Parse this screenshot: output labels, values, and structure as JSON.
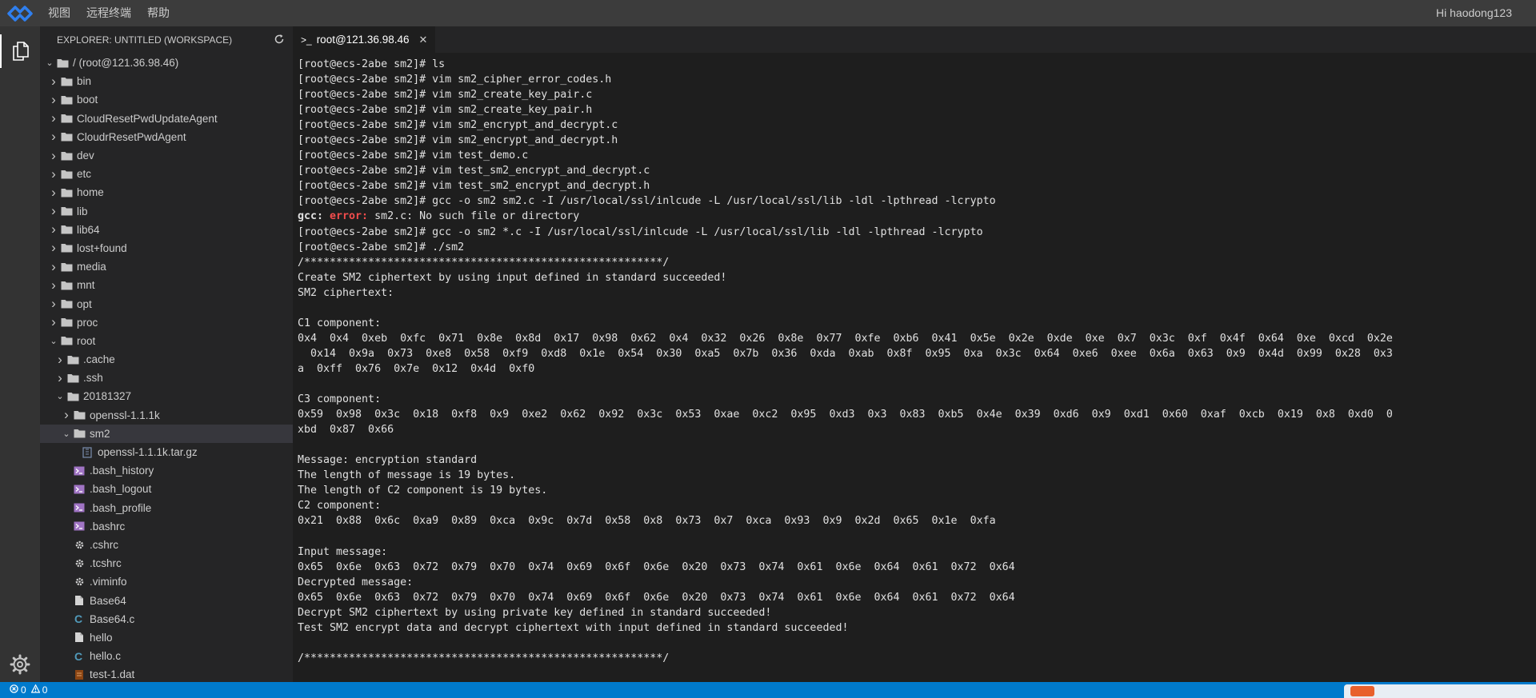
{
  "menubar": {
    "items": [
      "视图",
      "远程终端",
      "帮助"
    ],
    "greeting": "Hi haodong123"
  },
  "sidebar": {
    "title": "EXPLORER: UNTITLED (WORKSPACE)",
    "root_label": "/ (root@121.36.98.46)",
    "items": [
      {
        "label": "bin",
        "icon": "folder-icon",
        "level": 1,
        "expanded": false
      },
      {
        "label": "boot",
        "icon": "folder-icon",
        "level": 1,
        "expanded": false
      },
      {
        "label": "CloudResetPwdUpdateAgent",
        "icon": "folder-icon",
        "level": 1,
        "expanded": false
      },
      {
        "label": "CloudrResetPwdAgent",
        "icon": "folder-icon",
        "level": 1,
        "expanded": false
      },
      {
        "label": "dev",
        "icon": "folder-icon",
        "level": 1,
        "expanded": false
      },
      {
        "label": "etc",
        "icon": "folder-icon",
        "level": 1,
        "expanded": false
      },
      {
        "label": "home",
        "icon": "folder-icon",
        "level": 1,
        "expanded": false
      },
      {
        "label": "lib",
        "icon": "folder-icon",
        "level": 1,
        "expanded": false
      },
      {
        "label": "lib64",
        "icon": "folder-icon",
        "level": 1,
        "expanded": false
      },
      {
        "label": "lost+found",
        "icon": "folder-icon",
        "level": 1,
        "expanded": false
      },
      {
        "label": "media",
        "icon": "folder-icon",
        "level": 1,
        "expanded": false
      },
      {
        "label": "mnt",
        "icon": "folder-icon",
        "level": 1,
        "expanded": false
      },
      {
        "label": "opt",
        "icon": "folder-icon",
        "level": 1,
        "expanded": false
      },
      {
        "label": "proc",
        "icon": "folder-icon",
        "level": 1,
        "expanded": false
      },
      {
        "label": "root",
        "icon": "folder-icon",
        "level": 1,
        "expanded": true
      },
      {
        "label": ".cache",
        "icon": "folder-icon",
        "level": 2,
        "expanded": false
      },
      {
        "label": ".ssh",
        "icon": "folder-icon",
        "level": 2,
        "expanded": false
      },
      {
        "label": "20181327",
        "icon": "folder-icon",
        "level": 2,
        "expanded": true
      },
      {
        "label": "openssl-1.1.1k",
        "icon": "folder-icon",
        "level": 3,
        "expanded": false
      },
      {
        "label": "sm2",
        "icon": "folder-icon",
        "level": 3,
        "expanded": true,
        "selected": true
      },
      {
        "label": "openssl-1.1.1k.tar.gz",
        "icon": "archive-file-icon",
        "level": 4
      },
      {
        "label": ".bash_history",
        "icon": "shell-file-icon",
        "level": 3
      },
      {
        "label": ".bash_logout",
        "icon": "shell-file-icon",
        "level": 3
      },
      {
        "label": ".bash_profile",
        "icon": "shell-file-icon",
        "level": 3
      },
      {
        "label": ".bashrc",
        "icon": "shell-file-icon",
        "level": 3
      },
      {
        "label": ".cshrc",
        "icon": "gear-file-icon",
        "level": 3
      },
      {
        "label": ".tcshrc",
        "icon": "gear-file-icon",
        "level": 3
      },
      {
        "label": ".viminfo",
        "icon": "gear-file-icon",
        "level": 3
      },
      {
        "label": "Base64",
        "icon": "file-icon",
        "level": 3
      },
      {
        "label": "Base64.c",
        "icon": "c-file-icon",
        "level": 3
      },
      {
        "label": "hello",
        "icon": "file-icon",
        "level": 3
      },
      {
        "label": "hello.c",
        "icon": "c-file-icon",
        "level": 3
      },
      {
        "label": "test-1.dat",
        "icon": "data-file-icon",
        "level": 3
      }
    ]
  },
  "editor": {
    "tab_label": "root@121.36.98.46",
    "tab_prefix": ">_"
  },
  "terminal": {
    "lines": [
      "[root@ecs-2abe sm2]# ls",
      "[root@ecs-2abe sm2]# vim sm2_cipher_error_codes.h",
      "[root@ecs-2abe sm2]# vim sm2_create_key_pair.c",
      "[root@ecs-2abe sm2]# vim sm2_create_key_pair.h",
      "[root@ecs-2abe sm2]# vim sm2_encrypt_and_decrypt.c",
      "[root@ecs-2abe sm2]# vim sm2_encrypt_and_decrypt.h",
      "[root@ecs-2abe sm2]# vim test_demo.c",
      "[root@ecs-2abe sm2]# vim test_sm2_encrypt_and_decrypt.c",
      "[root@ecs-2abe sm2]# vim test_sm2_encrypt_and_decrypt.h",
      "[root@ecs-2abe sm2]# gcc -o sm2 sm2.c -I /usr/local/ssl/inlcude -L /usr/local/ssl/lib -ldl -lpthread -lcrypto",
      "",
      "[root@ecs-2abe sm2]# gcc -o sm2 *.c -I /usr/local/ssl/inlcude -L /usr/local/ssl/lib -ldl -lpthread -lcrypto",
      "[root@ecs-2abe sm2]# ./sm2",
      "/********************************************************/",
      "Create SM2 ciphertext by using input defined in standard succeeded!",
      "SM2 ciphertext:",
      "",
      "C1 component:",
      "0x4  0x4  0xeb  0xfc  0x71  0x8e  0x8d  0x17  0x98  0x62  0x4  0x32  0x26  0x8e  0x77  0xfe  0xb6  0x41  0x5e  0x2e  0xde  0xe  0x7  0x3c  0xf  0x4f  0x64  0xe  0xcd  0x2e",
      "  0x14  0x9a  0x73  0xe8  0x58  0xf9  0xd8  0x1e  0x54  0x30  0xa5  0x7b  0x36  0xda  0xab  0x8f  0x95  0xa  0x3c  0x64  0xe6  0xee  0x6a  0x63  0x9  0x4d  0x99  0x28  0x3",
      "a  0xff  0x76  0x7e  0x12  0x4d  0xf0",
      "",
      "C3 component:",
      "0x59  0x98  0x3c  0x18  0xf8  0x9  0xe2  0x62  0x92  0x3c  0x53  0xae  0xc2  0x95  0xd3  0x3  0x83  0xb5  0x4e  0x39  0xd6  0x9  0xd1  0x60  0xaf  0xcb  0x19  0x8  0xd0  0",
      "xbd  0x87  0x66",
      "",
      "Message: encryption standard",
      "The length of message is 19 bytes.",
      "The length of C2 component is 19 bytes.",
      "C2 component:",
      "0x21  0x88  0x6c  0xa9  0x89  0xca  0x9c  0x7d  0x58  0x8  0x73  0x7  0xca  0x93  0x9  0x2d  0x65  0x1e  0xfa",
      "",
      "Input message:",
      "0x65  0x6e  0x63  0x72  0x79  0x70  0x74  0x69  0x6f  0x6e  0x20  0x73  0x74  0x61  0x6e  0x64  0x61  0x72  0x64",
      "Decrypted message:",
      "0x65  0x6e  0x63  0x72  0x79  0x70  0x74  0x69  0x6f  0x6e  0x20  0x73  0x74  0x61  0x6e  0x64  0x61  0x72  0x64",
      "Decrypt SM2 ciphertext by using private key defined in standard succeeded!",
      "Test SM2 encrypt data and decrypt ciphertext with input defined in standard succeeded!",
      "",
      "/********************************************************/"
    ],
    "error_line": {
      "prefix": "gcc: ",
      "error": "error: ",
      "message": "sm2.c: No such file or directory"
    }
  },
  "statusbar": {
    "errors": "0",
    "warnings": "0"
  },
  "colors": {
    "status_blue": "#007acc",
    "error_red": "#f14c4c",
    "logo_blue": "#2f7fef"
  }
}
